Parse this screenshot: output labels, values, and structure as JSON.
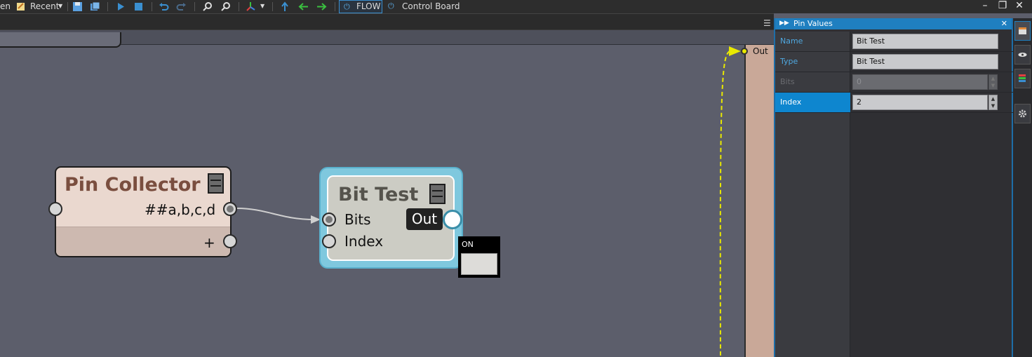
{
  "toolbar": {
    "open_label": "en",
    "recent_label": "Recent",
    "flow_label": "FLOW",
    "control_board_label": "Control Board"
  },
  "canvas": {
    "nodes": {
      "pin_collector": {
        "title": "Pin Collector",
        "pin_label": "##a,b,c,d",
        "add_label": "+"
      },
      "bit_test": {
        "title": "Bit Test",
        "bits_label": "Bits",
        "index_label": "Index",
        "out_label": "Out"
      }
    },
    "on_indicator": {
      "label": "ON"
    },
    "out_port_label": "Out"
  },
  "panel": {
    "title": "Pin Values",
    "rows": [
      {
        "label": "Name",
        "value": "Bit Test"
      },
      {
        "label": "Type",
        "value": "Bit Test"
      },
      {
        "label": "Bits",
        "value": "0"
      },
      {
        "label": "Index",
        "value": "2"
      }
    ]
  },
  "colors": {
    "accent": "#1f7fc0",
    "selection": "#0e86cf",
    "wire_highlight": "#e9e900"
  }
}
